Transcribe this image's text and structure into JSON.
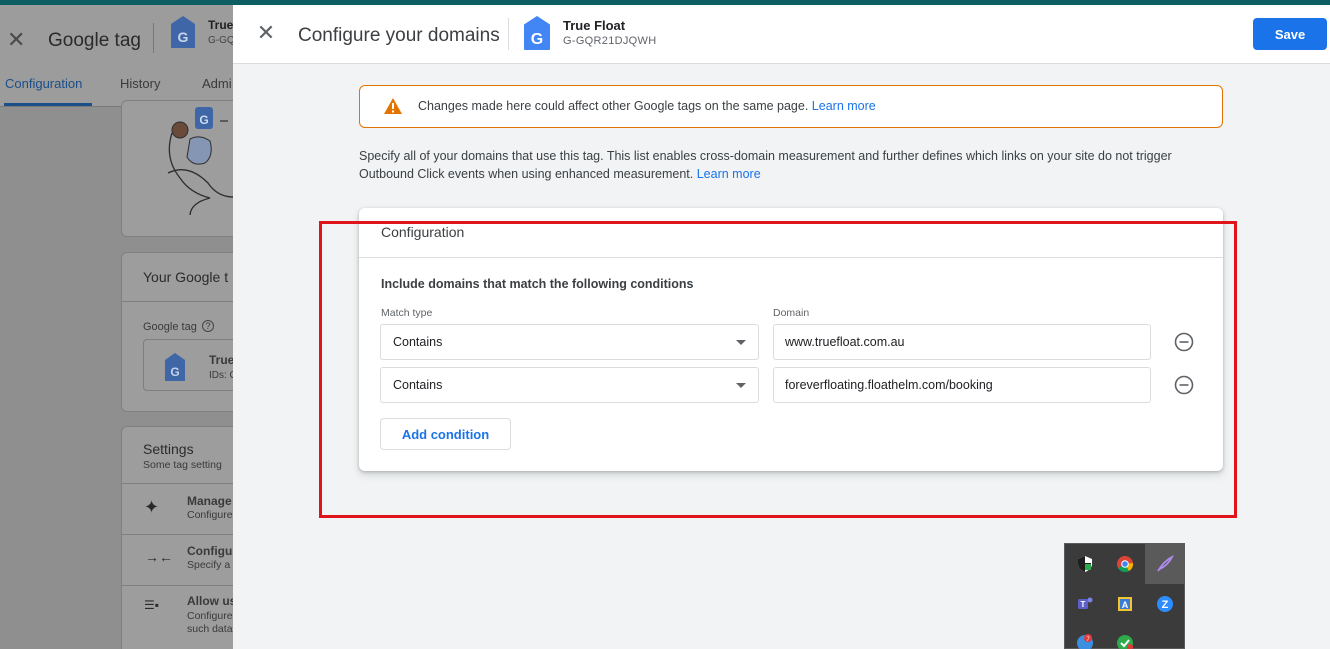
{
  "background_page": {
    "title": "Google tag",
    "tag_name_partial": "True",
    "tag_id_partial": "G-GQ",
    "tabs": [
      "Configuration",
      "History",
      "Admi"
    ],
    "your_tag_heading": "Your Google t",
    "google_tag_label": "Google tag",
    "tag_card_name": "True",
    "tag_card_ids": "IDs: G",
    "settings_heading": "Settings",
    "settings_sub": "Some tag setting",
    "settings_items": [
      {
        "title": "Manage",
        "sub": "Configure"
      },
      {
        "title": "Configu",
        "sub": "Specify a"
      },
      {
        "title": "Allow us",
        "sub": "Configure",
        "sub2": "such data"
      }
    ]
  },
  "dialog": {
    "title": "Configure your domains",
    "tag_name": "True Float",
    "tag_id": "G-GQR21DJQWH",
    "save_label": "Save",
    "warning": {
      "text": "Changes made here could affect other Google tags on the same page.",
      "link": "Learn more"
    },
    "description": {
      "line1": "Specify all of your domains that use this tag. This list enables cross-domain measurement and further defines which links on your site do not trigger",
      "line2": "Outbound Click events when using enhanced measurement.",
      "link": "Learn more"
    },
    "config": {
      "title": "Configuration",
      "heading": "Include domains that match the following conditions",
      "match_type_label": "Match type",
      "domain_label": "Domain",
      "conditions": [
        {
          "match_type": "Contains",
          "domain": "www.truefloat.com.au"
        },
        {
          "match_type": "Contains",
          "domain": "foreverfloating.floathelm.com/booking"
        }
      ],
      "add_condition_label": "Add condition"
    }
  },
  "tray": {
    "icons": [
      "security-shield-icon",
      "chrome-icon",
      "feather-icon",
      "teams-icon",
      "paint-icon",
      "zoom-icon",
      "chat-icon",
      "check-icon"
    ],
    "badge": "7"
  },
  "colors": {
    "accent": "#1a73e8",
    "warning": "#e37400",
    "highlight": "#e0141b"
  }
}
